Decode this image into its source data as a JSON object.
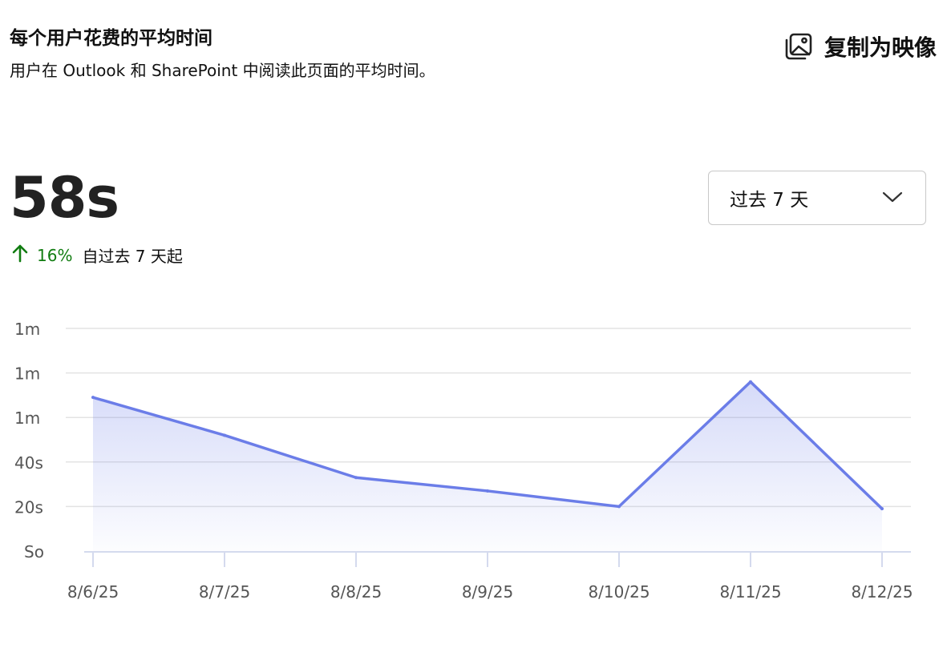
{
  "header": {
    "title": "每个用户花费的平均时间",
    "subtitle": "用户在 Outlook 和 SharePoint 中阅读此页面的平均时间。",
    "copy_label": "复制为映像"
  },
  "summary": {
    "value": "58s",
    "change_pct": "16%",
    "change_label": "自过去 7 天起"
  },
  "range_select": {
    "selected": "过去 7 天"
  },
  "colors": {
    "line": "#6b7de8",
    "grid": "#e3e3e3",
    "axis": "#c5cde8",
    "up": "#107c10"
  },
  "chart_data": {
    "type": "area",
    "categories": [
      "8/6/25",
      "8/7/25",
      "8/8/25",
      "8/9/25",
      "8/10/25",
      "8/11/25",
      "8/12/25"
    ],
    "series": [
      {
        "values": [
          69,
          52,
          33,
          27,
          20,
          76,
          19
        ]
      }
    ],
    "y_ticks": [
      {
        "value": 0,
        "label": "So"
      },
      {
        "value": 20,
        "label": "20s"
      },
      {
        "value": 40,
        "label": "40s"
      },
      {
        "value": 60,
        "label": "1m"
      },
      {
        "value": 80,
        "label": "1m"
      },
      {
        "value": 100,
        "label": "1m"
      }
    ],
    "ylim": [
      0,
      100
    ],
    "grid": true,
    "legend": "none"
  }
}
